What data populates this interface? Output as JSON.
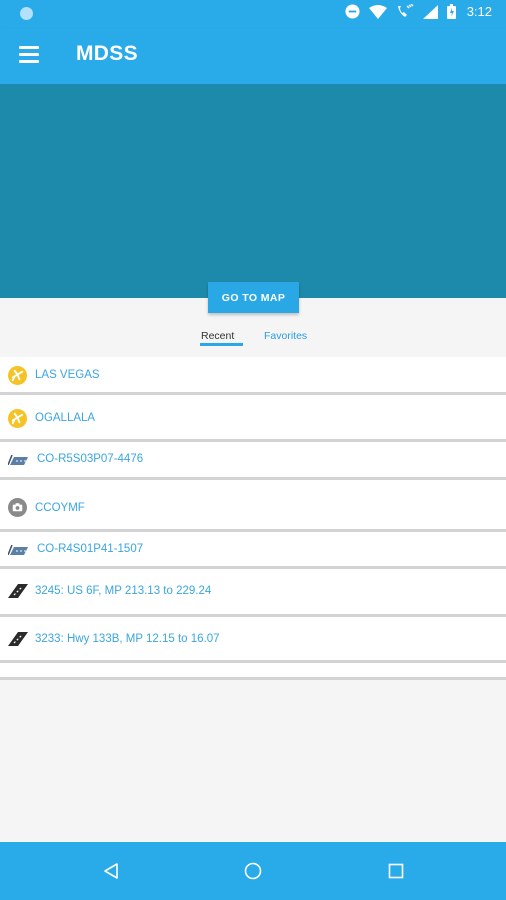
{
  "status_bar": {
    "time": "3:12"
  },
  "app_bar": {
    "title": "MDSS"
  },
  "map_button_label": "GO TO MAP",
  "tabs": [
    {
      "label": "Recent",
      "active": true
    },
    {
      "label": "Favorites",
      "active": false
    }
  ],
  "recent_items": [
    {
      "label": "LAS VEGAS",
      "icon": "airport-icon"
    },
    {
      "label": "OGALLALA",
      "icon": "airport-icon"
    },
    {
      "label": "CO-R5S03P07-4476",
      "icon": "road-segment-icon"
    },
    {
      "label": "CCOYMF",
      "icon": "camera-icon"
    },
    {
      "label": "CO-R4S01P41-1507",
      "icon": "road-segment-icon"
    },
    {
      "label": "3245: US 6F, MP 213.13 to 229.24",
      "icon": "road-icon"
    },
    {
      "label": "3233: Hwy 133B, MP 12.15 to 16.07",
      "icon": "road-icon"
    }
  ],
  "colors": {
    "primary": "#29aae9",
    "map": "#1e8aab",
    "airport": "#f5c325",
    "link": "#3aa5e0"
  }
}
